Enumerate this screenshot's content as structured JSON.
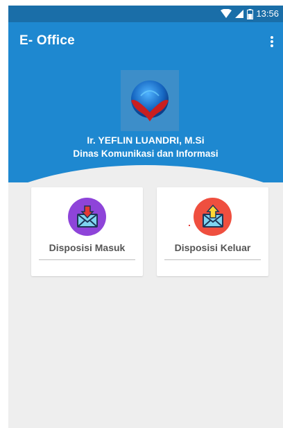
{
  "status_bar": {
    "time": "13:56",
    "icons": [
      "wifi-icon",
      "signal-icon",
      "battery-icon"
    ]
  },
  "app_bar": {
    "title": "E- Office",
    "menu_icon": "more-vert-icon"
  },
  "profile": {
    "name": "Ir. YEFLIN LUANDRI, M.Si",
    "department": "Dinas Komunikasi dan Informasi"
  },
  "menu": [
    {
      "label": "Disposisi Masuk",
      "icon": "mail-inbox-icon",
      "color": "#8e44d9"
    },
    {
      "label": "Disposisi Keluar",
      "icon": "mail-outbox-icon",
      "color": "#ef4f3f"
    }
  ],
  "colors": {
    "primary": "#1e88d0",
    "status_bar": "#1a6ea8",
    "background": "#eeeeee"
  }
}
